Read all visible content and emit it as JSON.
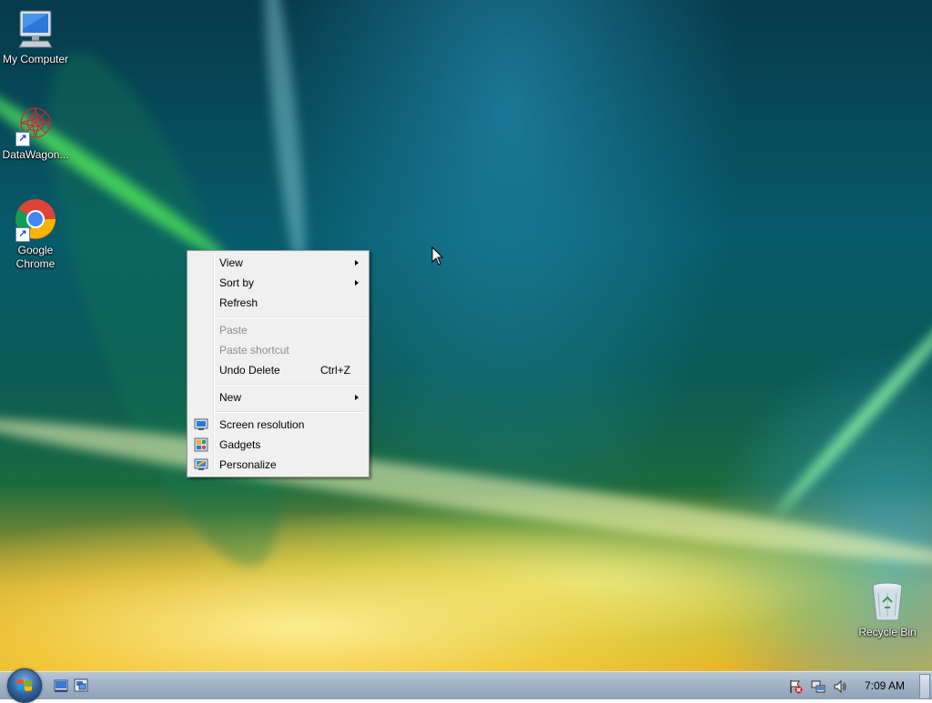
{
  "desktop": {
    "icons": [
      {
        "label": "My Computer",
        "icon": "computer-icon"
      },
      {
        "label": "DataWagon...",
        "icon": "datawagon-icon"
      },
      {
        "label": "Google Chrome",
        "icon": "chrome-icon"
      },
      {
        "label": "Recycle Bin",
        "icon": "recycle-bin-icon"
      }
    ]
  },
  "context_menu": {
    "items": [
      {
        "label": "View",
        "submenu": true
      },
      {
        "label": "Sort by",
        "submenu": true
      },
      {
        "label": "Refresh"
      },
      {
        "label": "Paste",
        "disabled": true
      },
      {
        "label": "Paste shortcut",
        "disabled": true
      },
      {
        "label": "Undo Delete",
        "accel": "Ctrl+Z"
      },
      {
        "label": "New",
        "submenu": true
      },
      {
        "label": "Screen resolution",
        "icon": "screen-resolution-icon"
      },
      {
        "label": "Gadgets",
        "icon": "gadgets-icon"
      },
      {
        "label": "Personalize",
        "icon": "personalize-icon"
      }
    ]
  },
  "taskbar": {
    "start_icon": "windows-flag-icon",
    "quick_launch": [
      "show-desktop-icon",
      "switch-windows-icon"
    ],
    "tray_icons": [
      "action-center-icon",
      "network-icon",
      "volume-icon"
    ],
    "clock": "7:09 AM"
  },
  "colors": {
    "menu_background": "#f0f0f0",
    "taskbar": "#a3b3c7",
    "disabled_text": "#8d8d8d"
  }
}
